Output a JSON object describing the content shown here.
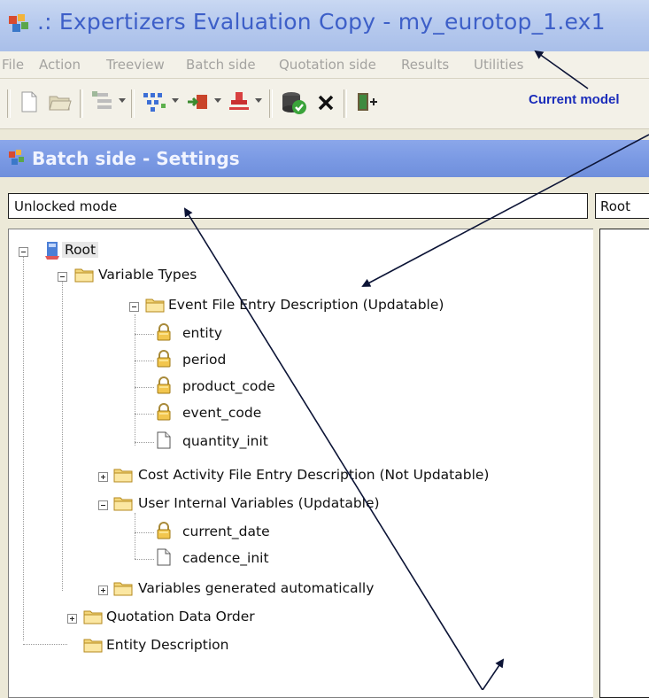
{
  "window": {
    "title": ".:  Expertizers Evaluation Copy  -  my_eurotop_1.ex1",
    "icon": "app-logo-icon"
  },
  "menu": {
    "items": [
      "File",
      "Action",
      "Treeview",
      "Batch side",
      "Quotation side",
      "Results",
      "Utilities"
    ]
  },
  "toolbar": {
    "buttons": [
      "new-document-icon",
      "open-folder-icon",
      "add-item-icon",
      "grid-tool-icon",
      "import-icon",
      "stamp-icon",
      "validate-icon",
      "delete-icon",
      "exit-icon"
    ]
  },
  "annotations": {
    "current_model": "Current model"
  },
  "panel": {
    "title": "Batch side - Settings"
  },
  "mode": {
    "text": "Unlocked mode"
  },
  "right_header": {
    "text": "Root"
  },
  "tree": {
    "root": "Root",
    "variable_types": "Variable Types",
    "event_file": "Event File Entry Description (Updatable)",
    "entity": "entity",
    "period": "period",
    "product_code": "product_code",
    "event_code": "event_code",
    "quantity_init": "quantity_init",
    "cost_activity": "Cost Activity File Entry Description (Not Updatable)",
    "user_internal": "User Internal Variables (Updatable)",
    "current_date": "current_date",
    "cadence_init": "cadence_init",
    "vars_generated": "Variables generated automatically",
    "quotation_order": "Quotation Data Order",
    "entity_description": "Entity Description"
  },
  "colors": {
    "title_text": "#3d5fc8",
    "panel_title_bg": "#7b9ae4",
    "annotation": "#1b2dba"
  }
}
